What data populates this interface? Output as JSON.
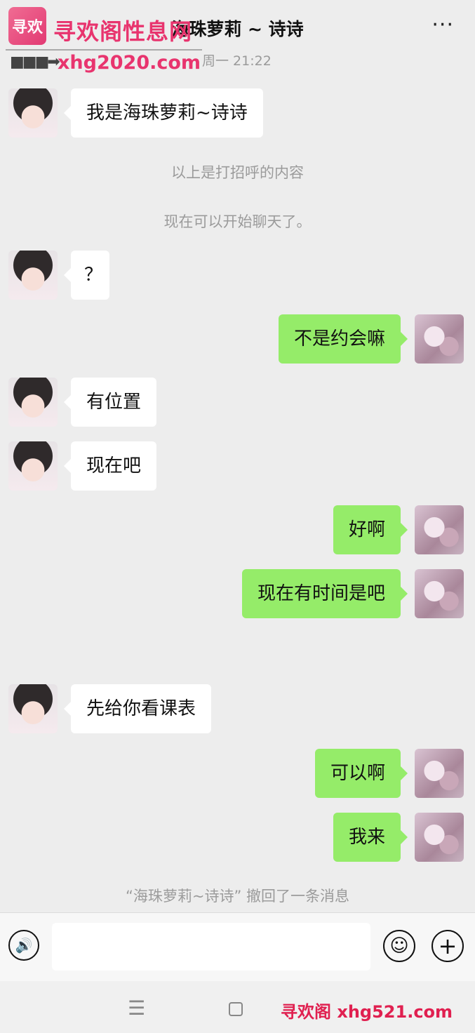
{
  "header": {
    "back_icon": "‹",
    "title": "海珠萝莉 ~ 诗诗",
    "more_icon": "···"
  },
  "watermark": {
    "logo_text": "寻欢",
    "site_name": "寻欢阁性息网",
    "arrow": "■■■➡",
    "url": "xhg2020.com",
    "bottom_text": "寻欢阁 xhg521.com"
  },
  "chat": {
    "timestamp": "周一 21:22",
    "messages": [
      {
        "side": "left",
        "text": "我是海珠萝莉~诗诗"
      },
      {
        "side": "left",
        "text": "？"
      },
      {
        "side": "right",
        "text": "不是约会嘛"
      },
      {
        "side": "left",
        "text": "有位置"
      },
      {
        "side": "left",
        "text": "现在吧"
      },
      {
        "side": "right",
        "text": "好啊"
      },
      {
        "side": "right",
        "text": "现在有时间是吧"
      },
      {
        "side": "left",
        "text": "先给你看课表"
      },
      {
        "side": "right",
        "text": "可以啊"
      },
      {
        "side": "right",
        "text": "我来"
      }
    ],
    "system": {
      "greeting_note": "以上是打招呼的内容",
      "start_note": "现在可以开始聊天了。",
      "recall_note": "“海珠萝莉~诗诗” 撤回了一条消息"
    }
  },
  "input_bar": {
    "voice_icon": "🔊",
    "emoji_icon": "☺",
    "plus_icon": "+",
    "placeholder": ""
  },
  "navbar": {
    "menu_icon": "☰"
  }
}
